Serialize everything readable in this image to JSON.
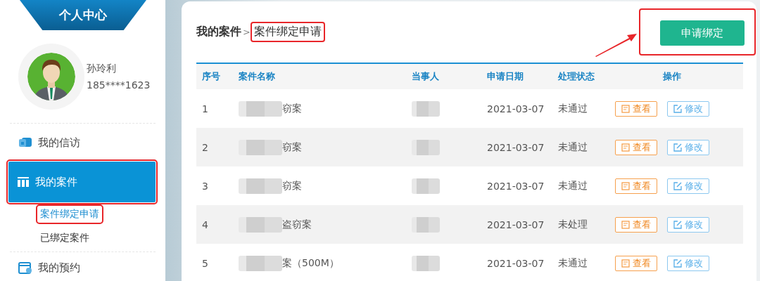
{
  "sidebar": {
    "title": "个人中心",
    "user": {
      "name": "孙玲利",
      "phone": "185****1623"
    },
    "menu": [
      {
        "label": "我的信访",
        "kind": "petition",
        "selected": false,
        "highlighted": false
      },
      {
        "label": "我的案件",
        "kind": "cases",
        "selected": true,
        "highlighted": true,
        "children": [
          {
            "label": "案件绑定申请",
            "selected": true,
            "highlighted": true
          },
          {
            "label": "已绑定案件",
            "selected": false,
            "highlighted": false
          }
        ]
      },
      {
        "label": "我的预约",
        "kind": "calendar",
        "selected": false,
        "highlighted": false
      }
    ]
  },
  "breadcrumb": {
    "parent": "我的案件",
    "separator": ">",
    "current": "案件绑定申请",
    "highlighted": true
  },
  "apply_button": {
    "label": "申请绑定",
    "highlighted": true
  },
  "table": {
    "columns": [
      "序号",
      "案件名称",
      "当事人",
      "申请日期",
      "处理状态",
      "操作"
    ],
    "rows": [
      {
        "index": "1",
        "case_name": "窃案",
        "name_redacted": true,
        "party_redacted": true,
        "date": "2021-03-07",
        "status": "未通过",
        "actions": [
          {
            "kind": "view",
            "label": "查看"
          },
          {
            "kind": "edit",
            "label": "修改"
          }
        ]
      },
      {
        "index": "2",
        "case_name": "窃案",
        "name_redacted": true,
        "party_redacted": true,
        "date": "2021-03-07",
        "status": "未通过",
        "actions": [
          {
            "kind": "view",
            "label": "查看"
          },
          {
            "kind": "edit",
            "label": "修改"
          }
        ]
      },
      {
        "index": "3",
        "case_name": "窃案",
        "name_redacted": true,
        "party_redacted": true,
        "date": "2021-03-07",
        "status": "未通过",
        "actions": [
          {
            "kind": "view",
            "label": "查看"
          },
          {
            "kind": "edit",
            "label": "修改"
          }
        ]
      },
      {
        "index": "4",
        "case_name": "盗窃案",
        "name_redacted": true,
        "party_redacted": true,
        "date": "2021-03-07",
        "status": "未处理",
        "actions": [
          {
            "kind": "view",
            "label": "查看"
          },
          {
            "kind": "edit",
            "label": "修改"
          }
        ]
      },
      {
        "index": "5",
        "case_name": "案（500M）",
        "name_redacted": true,
        "party_redacted": true,
        "date": "2021-03-07",
        "status": "未通过",
        "actions": [
          {
            "kind": "view",
            "label": "查看"
          },
          {
            "kind": "edit",
            "label": "修改"
          }
        ]
      }
    ]
  }
}
